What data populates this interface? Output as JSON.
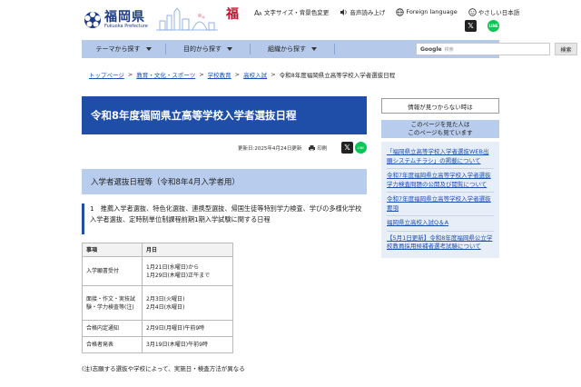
{
  "header": {
    "logo_kanji": "福岡県",
    "logo_roman": "Fukuoka Prefecture",
    "mascot_mark": "福",
    "utility": [
      {
        "label": "文字サイズ・背景色変更",
        "icon": "text-size-icon"
      },
      {
        "label": "音声読み上げ",
        "icon": "speaker-icon"
      },
      {
        "label": "Foreign language",
        "icon": "globe-icon"
      },
      {
        "label": "やさしい日本語",
        "icon": "smile-icon"
      }
    ],
    "x_label": "𝕏",
    "line_label": "LINE"
  },
  "nav": {
    "items": [
      "テーマから探す",
      "目的から探す",
      "組織から探す"
    ],
    "search_brand": "Google",
    "search_placeholder": "検索",
    "search_button": "検索"
  },
  "breadcrumb": {
    "links": [
      "トップページ",
      "教育・文化・スポーツ",
      "学校教育",
      "高校入試"
    ],
    "current": "令和8年度福岡県立高等学校入学者選抜日程"
  },
  "main": {
    "title": "令和8年度福岡県立高等学校入学者選抜日程",
    "updated": "更新日:2025年4月24日更新",
    "print": "印刷",
    "section": "入学者選抜日程等（令和8年4月入学者用）",
    "subsection": "1　推薦入学者選抜、特色化選抜、連携型選抜、帰国生徒等特別学力検査、学びの多様化学校入学者選抜、定時制単位制課程前期1期入学試験に関する日程",
    "table": {
      "headers": [
        "事項",
        "月日"
      ],
      "rows": [
        {
          "item": "入学願書受付",
          "date": "1月21日(水曜日)から\n1月29日(木曜日)正午まで"
        },
        {
          "item": "面接・作文・実技試験・学力検査等(注)",
          "date": "2月3日(火曜日)\n2月4日(水曜日)"
        },
        {
          "item": "合格内定通知",
          "date": "2月9日(月曜日)午前9時"
        },
        {
          "item": "合格者発表",
          "date": "3月19日(木曜日)午前9時"
        }
      ]
    },
    "note": "(注)志願する選抜や学校によって、実施日・検査方法が異なる"
  },
  "sidebar": {
    "not_found": "情報が見つからない時は",
    "heading": "このページを見た人は\nこのページも見ています",
    "links": [
      "「福岡県立高等学校入学者選抜WEB出願システムチラシ」の掲載について",
      "令和7年度福岡県立高等学校入学者選抜学力検査問題の公開及び閲覧について",
      "令和7年度福岡県立高等学校入学者選抜要項",
      "福岡県立高校入試Q＆A",
      "【5月1日更新】令和8年度福岡県公立学校教員採用候補者選考試験について"
    ]
  },
  "colors": {
    "brand_blue": "#1e4ea8",
    "nav_blue": "#b5c9ea",
    "light_blue": "#b8cdee",
    "link_blue": "#1a4fb5"
  }
}
